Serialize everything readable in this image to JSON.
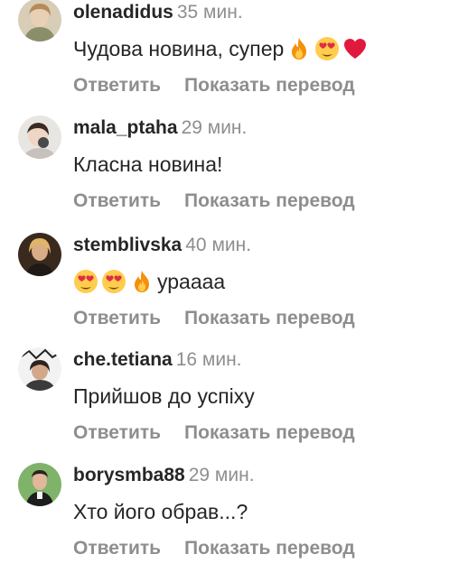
{
  "comments": [
    {
      "username": "olenadidus",
      "time": "35 мин.",
      "text": "Чудова новина, супер",
      "emojis_after": [
        "fire-emoji",
        "heart-eyes-emoji",
        "red-heart-emoji"
      ],
      "reply_label": "Ответить",
      "translate_label": "Показать перевод"
    },
    {
      "username": "mala_ptaha",
      "time": "29 мин.",
      "text": "Класна новина!",
      "reply_label": "Ответить",
      "translate_label": "Показать перевод"
    },
    {
      "username": "stemblivska",
      "time": "40 мин.",
      "emojis_before": [
        "heart-eyes-emoji",
        "heart-eyes-emoji",
        "fire-emoji"
      ],
      "text": "урaaaa",
      "reply_label": "Ответить",
      "translate_label": "Показать перевод"
    },
    {
      "username": "che.tetiana",
      "time": "16 мин.",
      "text": "Прийшов до успіху",
      "reply_label": "Ответить",
      "translate_label": "Показать перевод"
    },
    {
      "username": "borysmba88",
      "time": "29 мин.",
      "text": "Хто його обрав...?",
      "reply_label": "Ответить",
      "translate_label": "Показать перевод"
    }
  ],
  "colors": {
    "text": "#262626",
    "secondary": "#8e8e8e",
    "background": "#ffffff"
  }
}
